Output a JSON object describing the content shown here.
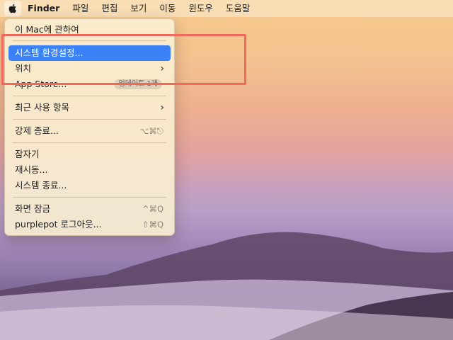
{
  "menubar": {
    "apple_icon": "apple-logo-icon",
    "items": [
      "Finder",
      "파일",
      "편집",
      "보기",
      "이동",
      "윈도우",
      "도움말"
    ]
  },
  "apple_menu": {
    "about": "이 Mac에 관하여",
    "system_prefs": "시스템 환경설정...",
    "location": "위치",
    "app_store": "App Store...",
    "app_store_badge": "업데이트 1개",
    "recent_items": "최근 사용 항목",
    "force_quit": "강제 종료...",
    "force_quit_shortcut": "⌥⌘⎋",
    "sleep": "잠자기",
    "restart": "재시동...",
    "shutdown": "시스템 종료...",
    "lock_screen": "화면 잠금",
    "lock_screen_shortcut": "^⌘Q",
    "logout": "purplepot 로그아웃...",
    "logout_shortcut": "⇧⌘Q"
  },
  "colors": {
    "highlight": "#3b82f6",
    "annotation_box": "#f06a5c"
  }
}
